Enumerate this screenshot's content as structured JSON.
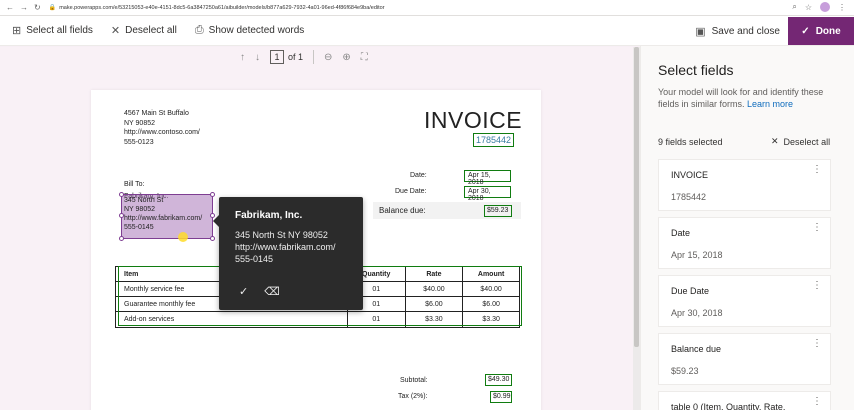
{
  "browser": {
    "url": "make.powerapps.com/e/53215053-e40e-4151-8dc5-6a3847250a61/aibuilder/models/b877a629-7932-4a01-96ed-4f86f684e9ba/editor"
  },
  "toolbar": {
    "select_all": "Select all fields",
    "deselect_all": "Deselect all",
    "show_words": "Show detected words",
    "save_close": "Save and close",
    "done": "Done"
  },
  "pager": {
    "page": "1",
    "of": "of 1"
  },
  "invoice": {
    "address": [
      "4567 Main St Buffalo",
      "NY 90852",
      "http://www.contoso.com/",
      "555-0123"
    ],
    "title": "INVOICE",
    "number": "1785442",
    "date_label": "Date:",
    "date_value": "Apr 15, 2018",
    "due_label": "Due Date:",
    "due_value": "Apr 30, 2018",
    "balance_label": "Balance due:",
    "balance_value": "$59.23",
    "bill_to": "Bill To:",
    "bill_to_lines": [
      "Fabrikam, Inc.",
      "345 North St",
      "NY 98052",
      "http://www.fabrikam.com/",
      "555-0145"
    ],
    "table": {
      "headers": [
        "Item",
        "Quantity",
        "Rate",
        "Amount"
      ],
      "rows": [
        [
          "Monthly service fee",
          "01",
          "$40.00",
          "$40.00"
        ],
        [
          "Guarantee monthly fee",
          "01",
          "$6.00",
          "$6.00"
        ],
        [
          "Add-on services",
          "01",
          "$3.30",
          "$3.30"
        ]
      ]
    },
    "subtotal_label": "Subtotal:",
    "subtotal_value": "$49.30",
    "tax_label": "Tax (2%):",
    "tax_value": "$0.99"
  },
  "popup": {
    "title": "Fabrikam, Inc.",
    "lines": [
      "345 North St NY 98052",
      "http://www.fabrikam.com/",
      "555-0145"
    ]
  },
  "panel": {
    "title": "Select fields",
    "desc": "Your model will look for and identify these fields in similar forms.",
    "learn_more": "Learn more",
    "selected_count": "9 fields selected",
    "deselect_all": "Deselect all",
    "cards": [
      {
        "title": "INVOICE",
        "value": "1785442"
      },
      {
        "title": "Date",
        "value": "Apr 15, 2018"
      },
      {
        "title": "Due Date",
        "value": "Apr 30, 2018"
      },
      {
        "title": "Balance due",
        "value": "$59.23"
      },
      {
        "title": "table 0 (Item, Quantity, Rate,",
        "value": ""
      }
    ]
  }
}
